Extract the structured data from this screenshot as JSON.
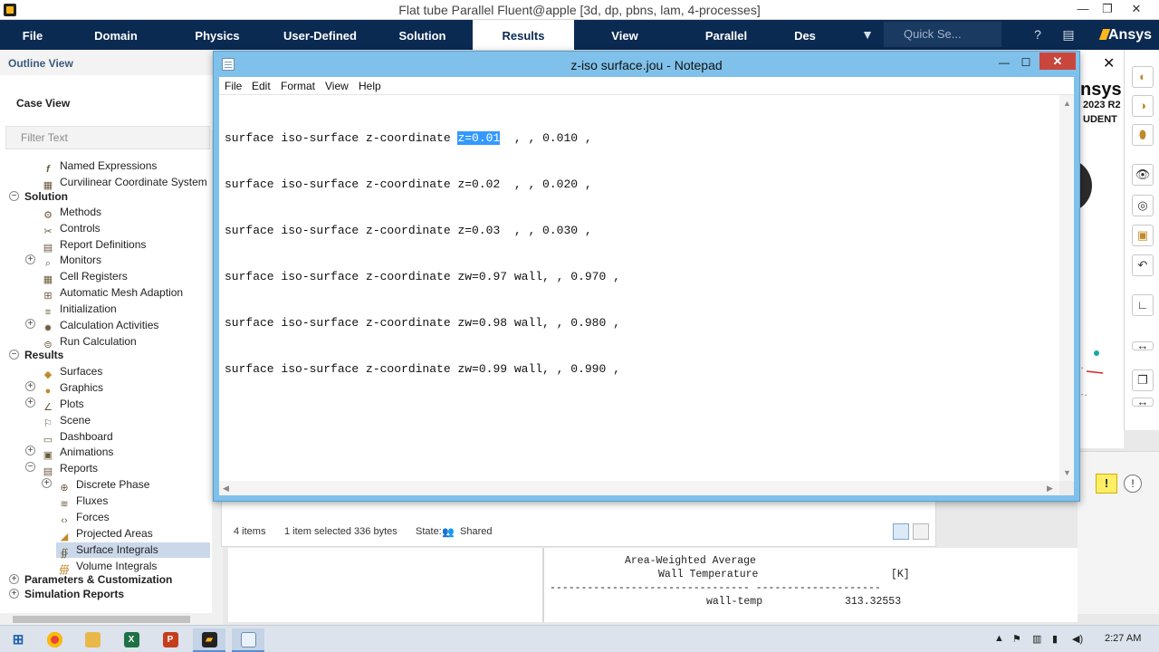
{
  "app": {
    "title": "Flat tube Parallel Fluent@apple  [3d, dp, pbns, lam, 4-processes]",
    "controls": {
      "minimize": "—",
      "restore": "❐",
      "close": "✕"
    }
  },
  "ribbon": {
    "tabs": [
      {
        "label": "File"
      },
      {
        "label": "Domain"
      },
      {
        "label": "Physics"
      },
      {
        "label": "User-Defined"
      },
      {
        "label": "Solution"
      },
      {
        "label": "Results"
      },
      {
        "label": "View"
      },
      {
        "label": "Parallel"
      },
      {
        "label": "Des"
      }
    ],
    "active_tab": "Results",
    "search_placeholder": "Quick Se...",
    "logo": "Ansys",
    "help_glyph": "?"
  },
  "outline": {
    "header": "Outline View",
    "case_view": "Case View",
    "filter_placeholder": "Filter Text",
    "items": [
      {
        "label": "Named Expressions",
        "icon": "fx"
      },
      {
        "label": "Curvilinear Coordinate System",
        "icon": "▦"
      },
      {
        "label": "Solution",
        "icon": "",
        "bold": true
      },
      {
        "label": "Methods",
        "icon": "⚙"
      },
      {
        "label": "Controls",
        "icon": "✂"
      },
      {
        "label": "Report Definitions",
        "icon": "▤"
      },
      {
        "label": "Monitors",
        "icon": "🔍"
      },
      {
        "label": "Cell Registers",
        "icon": "▦"
      },
      {
        "label": "Automatic Mesh Adaption",
        "icon": "⊞"
      },
      {
        "label": "Initialization",
        "icon": "≡"
      },
      {
        "label": "Calculation Activities",
        "icon": "✸"
      },
      {
        "label": "Run Calculation",
        "icon": "⊜"
      },
      {
        "label": "Results",
        "icon": "",
        "bold": true
      },
      {
        "label": "Surfaces",
        "icon": "◆"
      },
      {
        "label": "Graphics",
        "icon": "●"
      },
      {
        "label": "Plots",
        "icon": "∠"
      },
      {
        "label": "Scene",
        "icon": "⚐"
      },
      {
        "label": "Dashboard",
        "icon": "▭"
      },
      {
        "label": "Animations",
        "icon": "▣"
      },
      {
        "label": "Reports",
        "icon": "▤"
      },
      {
        "label": "Discrete Phase",
        "icon": "⊕"
      },
      {
        "label": "Fluxes",
        "icon": "≋"
      },
      {
        "label": "Forces",
        "icon": "⟨⟩"
      },
      {
        "label": "Projected Areas",
        "icon": "◢"
      },
      {
        "label": "Surface Integrals",
        "icon": "∯"
      },
      {
        "label": "Volume Integrals",
        "icon": "∰"
      },
      {
        "label": "Parameters & Customization",
        "icon": "",
        "bold": true
      },
      {
        "label": "Simulation Reports",
        "icon": "",
        "bold": true
      }
    ],
    "selected": "Surface Integrals"
  },
  "notepad": {
    "title": "z-iso surface.jou - Notepad",
    "menu": [
      "File",
      "Edit",
      "Format",
      "View",
      "Help"
    ],
    "lines": [
      {
        "pre": "surface iso-surface z-coordinate ",
        "sel": "z=0.01",
        "post": "  , , 0.010 ,"
      },
      {
        "pre": "surface iso-surface z-coordinate z=0.02  , , 0.020 ,",
        "sel": "",
        "post": ""
      },
      {
        "pre": "surface iso-surface z-coordinate z=0.03  , , 0.030 ,",
        "sel": "",
        "post": ""
      },
      {
        "pre": "surface iso-surface z-coordinate zw=0.97 wall, , 0.970 ,",
        "sel": "",
        "post": ""
      },
      {
        "pre": "surface iso-surface z-coordinate zw=0.98 wall, , 0.980 ,",
        "sel": "",
        "post": ""
      },
      {
        "pre": "surface iso-surface z-coordinate zw=0.99 wall, , 0.990 ,",
        "sel": "",
        "post": ""
      }
    ]
  },
  "explorer": {
    "items": "4 items",
    "selected": "1 item selected  336 bytes",
    "state_label": "State:",
    "state_value": "Shared"
  },
  "console": {
    "line1": "Area-Weighted Average",
    "line2": "Wall Temperature",
    "unit": "[K]",
    "rule": "-------------------------------- --------------------",
    "row_label": "wall-temp",
    "row_value": "313.32553"
  },
  "graphics": {
    "logo_text": "nsys",
    "version": "2023 R2",
    "edition": "UDENT"
  },
  "taskbar": {
    "time": "2:27 AM",
    "apps": [
      "start",
      "chrome",
      "file-explorer",
      "excel",
      "powerpoint",
      "fluent",
      "notepad"
    ]
  },
  "colors": {
    "ribbon_bg": "#0b2a52",
    "accent": "#ffb71b",
    "selection": "#3399ff",
    "notepad_frame": "#7fc1ea"
  }
}
